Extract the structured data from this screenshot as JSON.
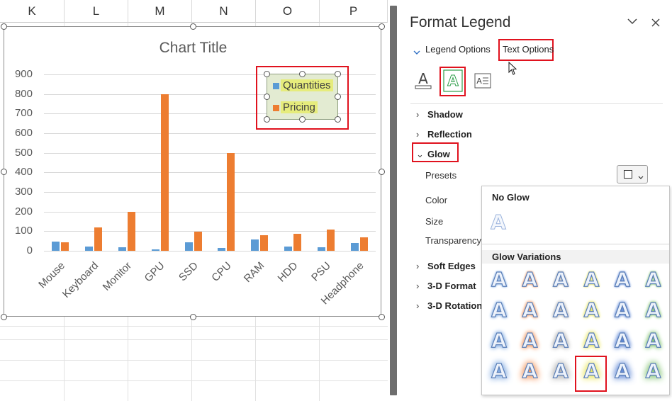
{
  "sheet": {
    "columns": [
      "K",
      "L",
      "M",
      "N",
      "O",
      "P"
    ]
  },
  "chart": {
    "title": "Chart Title",
    "legend": [
      "Quantities",
      "Pricing"
    ]
  },
  "chart_data": {
    "type": "bar",
    "title": "Chart Title",
    "categories": [
      "Mouse",
      "Keyboard",
      "Monitor",
      "GPU",
      "SSD",
      "CPU",
      "RAM",
      "HDD",
      "PSU",
      "Headphone"
    ],
    "series": [
      {
        "name": "Quantities",
        "values": [
          48,
          20,
          17,
          8,
          45,
          14,
          58,
          21,
          18,
          38
        ],
        "color": "#5b9bd5"
      },
      {
        "name": "Pricing",
        "values": [
          45,
          120,
          200,
          800,
          98,
          500,
          80,
          88,
          110,
          68
        ],
        "color": "#ed7d31"
      }
    ],
    "yticks": [
      0,
      100,
      200,
      300,
      400,
      500,
      600,
      700,
      800,
      900
    ],
    "ylim": [
      0,
      900
    ],
    "grid": true,
    "legend_position": "top-right"
  },
  "pane": {
    "title": "Format Legend",
    "tab_legend_options": "Legend Options",
    "tab_text_options": "Text Options",
    "sections": {
      "shadow": "Shadow",
      "reflection": "Reflection",
      "glow": "Glow",
      "soft_edges": "Soft Edges",
      "format_3d": "3-D Format",
      "rotation_3d": "3-D Rotation"
    },
    "props": {
      "presets": "Presets",
      "color": "Color",
      "size": "Size",
      "transparency": "Transparency"
    }
  },
  "gallery": {
    "no_glow": "No Glow",
    "variations": "Glow Variations",
    "letter": "A",
    "glow_colors": [
      "#6f9fdc",
      "#f08a4a",
      "#a8a8a8",
      "#e8e44a",
      "#4b78d0",
      "#7cc06a"
    ]
  },
  "colors": {
    "accent_red": "#e0121e",
    "quantities": "#5b9bd5",
    "pricing": "#ed7d31"
  }
}
